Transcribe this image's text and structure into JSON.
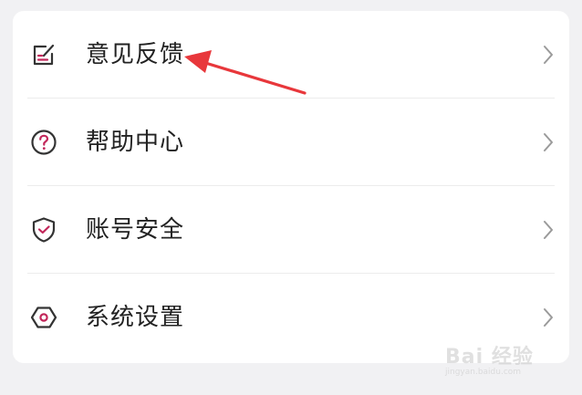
{
  "menu": {
    "items": [
      {
        "label": "意见反馈",
        "icon": "feedback-edit-icon"
      },
      {
        "label": "帮助中心",
        "icon": "help-question-icon"
      },
      {
        "label": "账号安全",
        "icon": "security-shield-icon"
      },
      {
        "label": "系统设置",
        "icon": "settings-hexagon-icon"
      }
    ],
    "chevron_icon": "chevron-right-icon"
  },
  "annotation": {
    "arrow_color": "#e8373b",
    "points_to": "意见反馈"
  },
  "watermark": {
    "logo_text": "Bai 经验",
    "sub_text": "jingyan.baidu.com"
  },
  "colors": {
    "icon_accent": "#c2275a",
    "icon_stroke": "#333333",
    "background": "#f1f1f3"
  }
}
